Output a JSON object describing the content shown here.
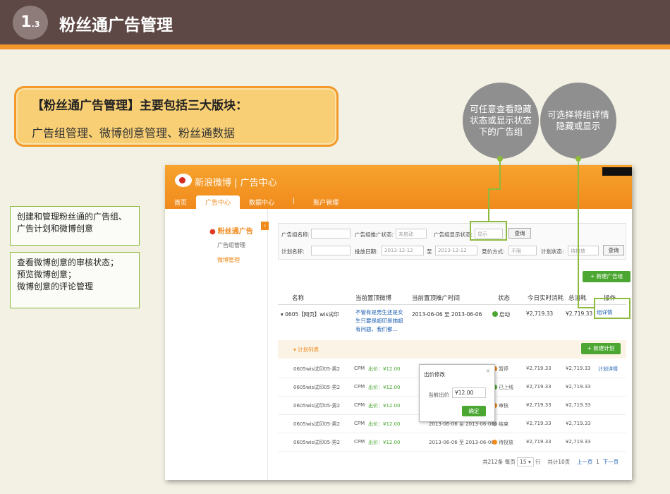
{
  "header": {
    "badge_num": "1",
    "badge_sub": ".3",
    "title": "粉丝通广告管理"
  },
  "callout": {
    "title": "【粉丝通广告管理】主要包括三大版块：",
    "body": "广告组管理、微博创意管理、粉丝通数据"
  },
  "bubbles": {
    "left": "可任意查看隐藏状态或显示状态下的广告组",
    "right": "可选择将组详情隐藏或显示"
  },
  "left_boxes": {
    "box1": "创建和管理粉丝通的广告组、广告计划和微博创意",
    "box2_line1": "查看微博创意的审核状态；",
    "box2_line2": "预览微博创意；",
    "box2_line3": "微博创意的评论管理"
  },
  "shot": {
    "brand": "新浪微博 | 广告中心",
    "nav": [
      "首页",
      "广告中心",
      "数据中心",
      "|",
      "账户管理"
    ],
    "side": {
      "header": "粉丝通广告",
      "item1": "广告组管理",
      "item2": "微博管理"
    },
    "filter": {
      "group_name_label": "广告组名称:",
      "group_status_label": "广告组推广状态:",
      "group_status_value": "未启动",
      "display_status_label": "广告组显示状态:",
      "display_status_value": "显示",
      "query1": "查询",
      "plan_name_label": "计划名称:",
      "date_label": "投放日期:",
      "date_from": "2013-12-12",
      "date_to_sep": "至",
      "date_to": "2013-12-12",
      "bid_label": "竞价方式:",
      "bid_value": "不限",
      "plan_status_label": "计划状态:",
      "plan_status_value": "待投放",
      "query2": "查询"
    },
    "new_group": "+ 新建广告组",
    "table_headers": [
      "名称",
      "当前置顶微博",
      "当前置顶推广时间",
      "状态",
      "今日实时消耗",
      "总消耗",
      "操作"
    ],
    "group_row": {
      "name": "▾ 0605【网页】wis试印",
      "weibo": "不管有是男生还是女生只要是超印是她超有问题，我们都...",
      "time": "2013-06-06 至 2013-06-06",
      "status": "启动",
      "cost_today": "¥2,719.33",
      "cost_total": "¥2,719.33",
      "action": "组详情"
    },
    "plan_header": "▾ 计划列表",
    "new_plan": "+ 新建计划",
    "plans": [
      {
        "name": "0605wis试印05-男2",
        "type": "CPM",
        "bid": "出价：¥12.00",
        "time": "",
        "status": "暂停",
        "cost_today": "¥2,719.33",
        "cost_total": "¥2,719.33",
        "action": "计划详情",
        "color": "#f08a1c"
      },
      {
        "name": "0605wis试印05-男2",
        "type": "CPM",
        "bid": "出价：¥12.00",
        "time": "",
        "status": "已上线",
        "cost_today": "¥2,719.33",
        "cost_total": "¥2,719.33",
        "action": "",
        "color": "#4ba732"
      },
      {
        "name": "0605wis试印05-男2",
        "type": "CPM",
        "bid": "出价：¥12.00",
        "time": "",
        "status": "审核",
        "cost_today": "¥2,719.33",
        "cost_total": "¥2,719.33",
        "action": "",
        "color": "#f08a1c"
      },
      {
        "name": "0605wis试印05-男2",
        "type": "CPM",
        "bid": "出价：¥12.00",
        "time": "2013-06-06 至 2013-06-06",
        "status": "结束",
        "cost_today": "¥2,719.33",
        "cost_total": "¥2,719.33",
        "action": "",
        "color": "#999999"
      },
      {
        "name": "0605wis试印05-男2",
        "type": "CPM",
        "bid": "出价：¥12.00",
        "time": "2013-06-06 至 2013-06-06",
        "status": "待投放",
        "cost_today": "¥2,719.33",
        "cost_total": "¥2,719.33",
        "action": "",
        "color": "#f08a1c"
      }
    ],
    "popup": {
      "title": "出价修改",
      "close": "×",
      "label": "当前出价",
      "value": "¥12.00",
      "confirm": "确定"
    },
    "pager": {
      "total": "共212条 每页",
      "per_page": "15 ▾",
      "row_unit": "行",
      "pages": "共计10页",
      "prev": "上一页",
      "current": "1",
      "next": "下一页"
    }
  }
}
